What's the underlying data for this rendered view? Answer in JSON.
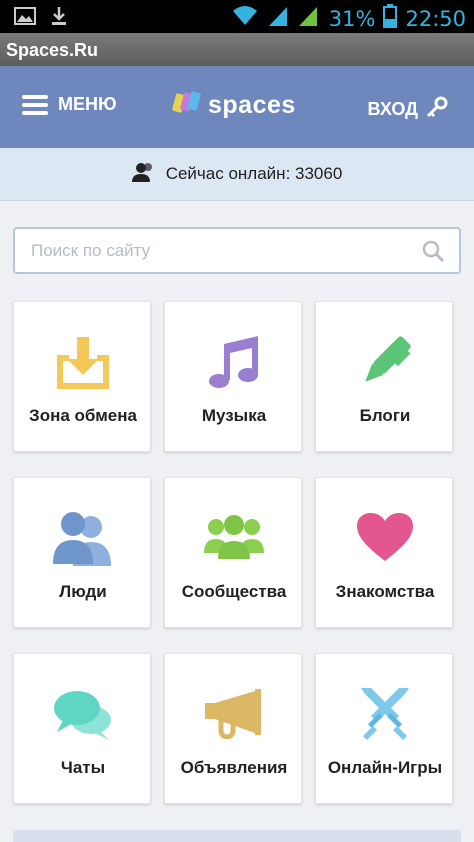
{
  "status_bar": {
    "icons_left": [
      "image-icon",
      "download-icon"
    ],
    "icons_right": [
      "wifi-icon",
      "signal-icon",
      "signal-icon",
      "battery-icon"
    ],
    "battery": "31%",
    "time": "22:50"
  },
  "window": {
    "title": "Spaces.Ru"
  },
  "header": {
    "menu_label": "МЕНЮ",
    "logo_text": "spaces",
    "login_label": "ВХОД",
    "background": "#6e88bd"
  },
  "online": {
    "text": "Сейчас онлайн: 33060"
  },
  "search": {
    "placeholder": "Поиск по сайту",
    "value": ""
  },
  "tiles": [
    {
      "label": "Зона обмена",
      "icon": "download-tray-icon",
      "color": "#f5c85a"
    },
    {
      "label": "Музыка",
      "icon": "music-note-icon",
      "color": "#9a7fd1"
    },
    {
      "label": "Блоги",
      "icon": "pen-icon",
      "color": "#5ac477"
    },
    {
      "label": "Люди",
      "icon": "people-icon",
      "color": "#6f96cb"
    },
    {
      "label": "Сообщества",
      "icon": "community-icon",
      "color": "#8bcf4f"
    },
    {
      "label": "Знакомства",
      "icon": "heart-icon",
      "color": "#e4568e"
    },
    {
      "label": "Чаты",
      "icon": "chat-icon",
      "color": "#5fd6c3"
    },
    {
      "label": "Объявления",
      "icon": "megaphone-icon",
      "color": "#dbb766"
    },
    {
      "label": "Онлайн-Игры",
      "icon": "swords-icon",
      "color": "#7ec8ea"
    }
  ]
}
